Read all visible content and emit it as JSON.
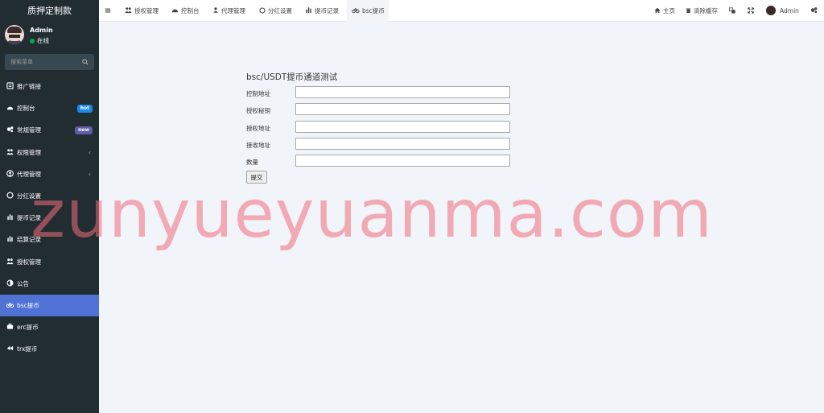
{
  "app": {
    "brand": "质押定制款"
  },
  "user": {
    "name": "Admin",
    "status": "在线"
  },
  "search": {
    "placeholder": "搜索菜单"
  },
  "sidebar": {
    "items": [
      {
        "label": "推广链接",
        "icon": "list-icon"
      },
      {
        "label": "控制台",
        "icon": "dashboard-icon",
        "badge": "hot"
      },
      {
        "label": "常规管理",
        "icon": "cogs-icon",
        "badge": "new"
      },
      {
        "label": "权限管理",
        "icon": "users-icon",
        "caret": "‹"
      },
      {
        "label": "代理管理",
        "icon": "user-circle-icon",
        "caret": "‹"
      },
      {
        "label": "分红设置",
        "icon": "circle-icon"
      },
      {
        "label": "提币记录",
        "icon": "bar-chart-icon"
      },
      {
        "label": "结算记录",
        "icon": "bar-chart-icon"
      },
      {
        "label": "授权管理",
        "icon": "users-icon"
      },
      {
        "label": "公告",
        "icon": "adjust-icon"
      },
      {
        "label": "bsc提币",
        "icon": "bicycle-icon",
        "active": true
      },
      {
        "label": "erc提币",
        "icon": "briefcase-icon"
      },
      {
        "label": "trx提币",
        "icon": "backward-icon"
      }
    ]
  },
  "topbar": {
    "tabs": [
      {
        "label": "授权管理",
        "icon": "users-icon"
      },
      {
        "label": "控制台",
        "icon": "dashboard-icon"
      },
      {
        "label": "代理管理",
        "icon": "user-icon"
      },
      {
        "label": "分红设置",
        "icon": "circle-icon"
      },
      {
        "label": "提币记录",
        "icon": "bar-chart-icon"
      },
      {
        "label": "bsc提币",
        "icon": "bicycle-icon",
        "active": true
      }
    ],
    "home_label": "主页",
    "clear_cache_label": "清除缓存",
    "admin_label": "Admin"
  },
  "form": {
    "title": "bsc/USDT提币通道测试",
    "fields": [
      {
        "label": "控制地址",
        "value": ""
      },
      {
        "label": "授权秘钥",
        "value": ""
      },
      {
        "label": "授权地址",
        "value": ""
      },
      {
        "label": "接收地址",
        "value": ""
      },
      {
        "label": "数量",
        "value": ""
      }
    ],
    "submit_label": "提交"
  },
  "watermark": {
    "text": "zunyueyuanma.com"
  },
  "colors": {
    "sidebar_bg": "#222d32",
    "active_menu": "#4f72d4",
    "badge_hot": "#1a8ce8",
    "badge_new": "#605ca8",
    "online": "#00a65a",
    "content_bg": "#f1f4f8"
  }
}
